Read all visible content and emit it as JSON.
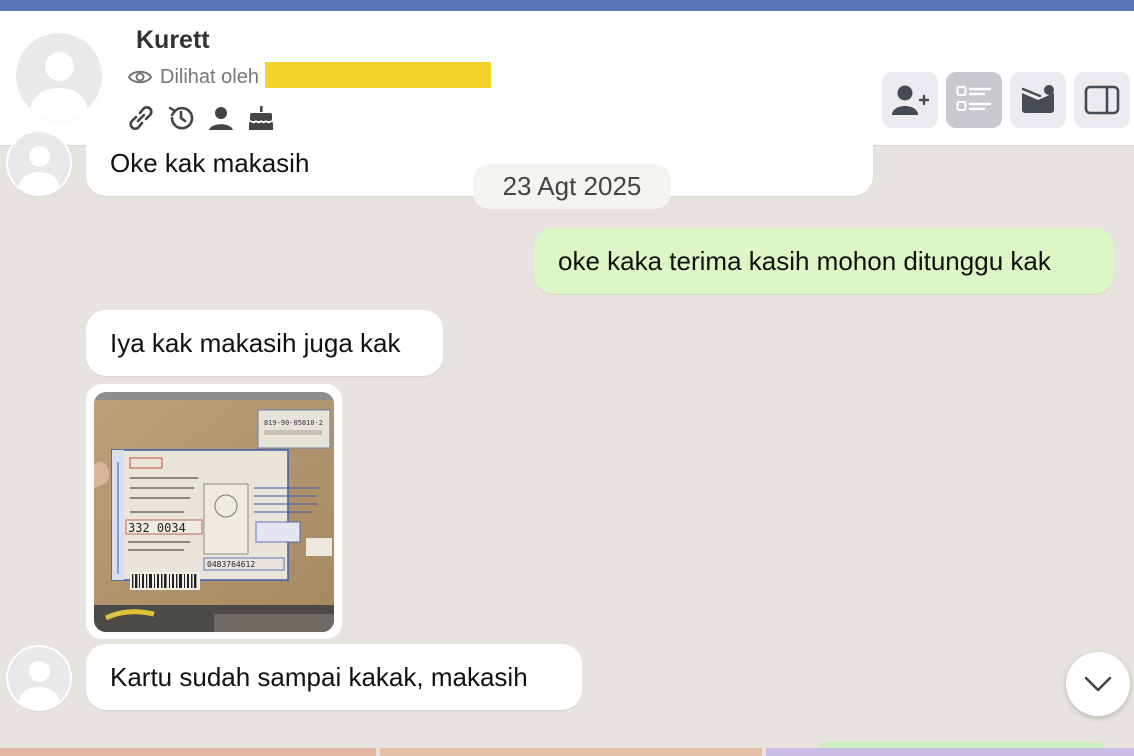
{
  "header": {
    "contact_name": "Kurett",
    "seen_by_label": "Dilihat oleh",
    "info_icons": [
      "link-icon",
      "history-icon",
      "person-icon",
      "cake-icon"
    ],
    "actions": [
      "add-contact-icon",
      "checklist-icon",
      "mail-badge-icon",
      "side-panel-icon"
    ]
  },
  "chat": {
    "date_label": "23 Agt 2025",
    "messages": [
      {
        "direction": "in",
        "text": "Oke kak makasih"
      },
      {
        "direction": "out",
        "text": "oke kaka terima kasih mohon ditunggu kak"
      },
      {
        "direction": "in",
        "text": "Iya kak makasih juga kak"
      },
      {
        "direction": "in",
        "type": "image",
        "text": ""
      },
      {
        "direction": "in",
        "text": "Kartu sudah sampai kakak, makasih"
      }
    ]
  },
  "photo": {
    "tracking_number": "819-90-05810-2",
    "postal_code": "332 0034",
    "barcode_number": "0483764612"
  },
  "colors": {
    "accent": "#5a75b8",
    "outgoing_bubble": "#dcf7c5",
    "incoming_bubble": "#ffffff",
    "chat_background": "#e7e3de",
    "redaction": "#f5d22a"
  }
}
